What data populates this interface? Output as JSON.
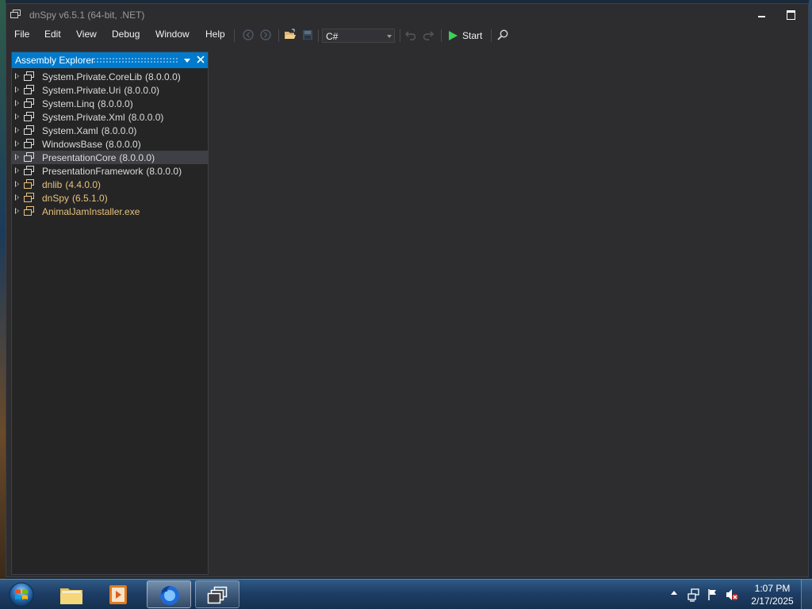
{
  "window": {
    "title": "dnSpy v6.5.1 (64-bit, .NET)"
  },
  "menu": {
    "items": [
      "File",
      "Edit",
      "View",
      "Debug",
      "Window",
      "Help"
    ]
  },
  "toolbar": {
    "language_value": "C#",
    "start_label": "Start"
  },
  "explorer": {
    "title": "Assembly Explorer",
    "items": [
      {
        "name": "System.Private.CoreLib",
        "version": "(8.0.0.0)",
        "kind": "gac",
        "selected": false
      },
      {
        "name": "System.Private.Uri",
        "version": "(8.0.0.0)",
        "kind": "gac",
        "selected": false
      },
      {
        "name": "System.Linq",
        "version": "(8.0.0.0)",
        "kind": "gac",
        "selected": false
      },
      {
        "name": "System.Private.Xml",
        "version": "(8.0.0.0)",
        "kind": "gac",
        "selected": false
      },
      {
        "name": "System.Xaml",
        "version": "(8.0.0.0)",
        "kind": "gac",
        "selected": false
      },
      {
        "name": "WindowsBase",
        "version": "(8.0.0.0)",
        "kind": "gac",
        "selected": false
      },
      {
        "name": "PresentationCore",
        "version": "(8.0.0.0)",
        "kind": "gac",
        "selected": true
      },
      {
        "name": "PresentationFramework",
        "version": "(8.0.0.0)",
        "kind": "gac",
        "selected": false
      },
      {
        "name": "dnlib",
        "version": "(4.4.0.0)",
        "kind": "user",
        "selected": false
      },
      {
        "name": "dnSpy",
        "version": "(6.5.1.0)",
        "kind": "user",
        "selected": false
      },
      {
        "name": "AnimalJamInstaller.exe",
        "version": "",
        "kind": "user",
        "selected": false
      }
    ]
  },
  "taskbar": {
    "apps": [
      "file-explorer-icon",
      "media-player-icon",
      "firefox-icon",
      "dnspy-icon"
    ],
    "active_app": "firefox-icon",
    "clock_time": "1:07 PM",
    "clock_date": "2/17/2025"
  },
  "colors": {
    "accent": "#007acc",
    "background": "#2d2d30",
    "panel": "#252526",
    "gac_text": "#dcdcdc",
    "user_assembly_text": "#e8c17a",
    "selection": "#3f3f46",
    "start_green": "#3ecf5a"
  }
}
